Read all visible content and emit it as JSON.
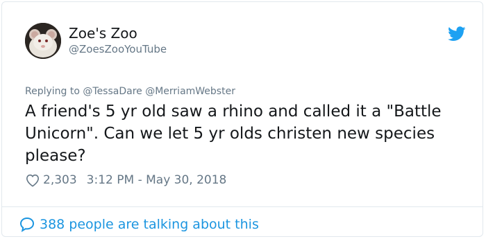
{
  "author": {
    "display_name": "Zoe's Zoo",
    "handle": "@ZoesZooYouTube"
  },
  "reply": {
    "prefix": "Replying to",
    "mentions": [
      "@TessaDare",
      "@MerriamWebster"
    ]
  },
  "tweet": {
    "text": "A friend's 5 yr old saw a rhino and called it a \"Battle Unicorn\". Can we let 5 yr olds christen new species please?"
  },
  "meta": {
    "likes": "2,303",
    "timestamp": "3:12 PM - May 30, 2018"
  },
  "footer": {
    "conversation": "388 people are talking about this"
  },
  "icons": {
    "brand": "twitter-bird-icon",
    "like": "heart-icon",
    "conversation": "speech-bubble-icon"
  },
  "colors": {
    "brand_blue": "#1da1f2",
    "link_blue": "#1b95e0",
    "text": "#14171a",
    "muted": "#657786",
    "border": "#e1e8ed"
  }
}
